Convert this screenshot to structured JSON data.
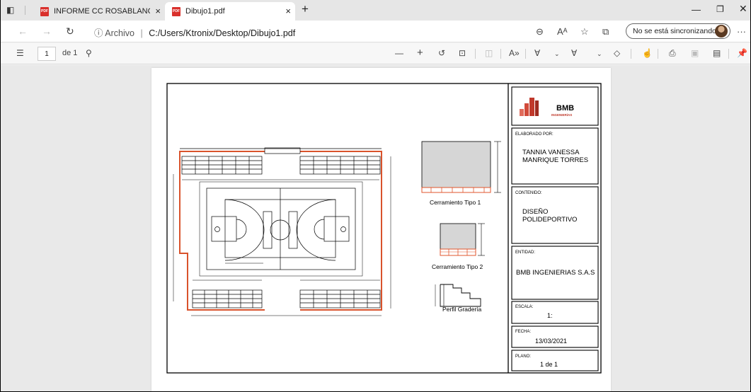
{
  "browser": {
    "tabs": [
      {
        "label": "INFORME CC ROSABLANCA ALE",
        "icon_text": "PDF"
      },
      {
        "label": "Dibujo1.pdf",
        "icon_text": "PDF"
      }
    ],
    "new_tab_glyph": "+",
    "tab_close_glyph": "×",
    "url_prefix": "ⓘ Archivo",
    "url_separator": "|",
    "url": "C:/Users/Ktronix/Desktop/Dibujo1.pdf",
    "sync_label": "No se está sincronizando",
    "more_glyph": "···"
  },
  "pdf_toolbar": {
    "page_current": "1",
    "page_of": "de 1"
  },
  "drawing": {
    "logo_text": "BMB",
    "logo_subtext": "INGENIERÍAS",
    "elaborado_label": "ELABORADO POR:",
    "elaborado_line1": "TANNIA VANESSA",
    "elaborado_line2": "MANRIQUE TORRES",
    "contenido_label": "CONTENIDO:",
    "contenido_line1": "DISEÑO",
    "contenido_line2": "POLIDEPORTIVO",
    "entidad_label": "ENTIDAD:",
    "entidad_value": "BMB INGENIERIAS S.A.S",
    "escala_label": "ESCALA:",
    "escala_value": "1:",
    "fecha_label": "FECHA:",
    "fecha_value": "13/03/2021",
    "plano_label": "PLANO:",
    "plano_value": "1 de 1",
    "detail1_caption": "Cerramiento Tipo 1",
    "detail2_caption": "Cerramiento Tipo 2",
    "detail3_caption": "Perfil Gradería"
  },
  "colors": {
    "enclosure_red": "#d9532c",
    "logo_red": "#c0392b"
  }
}
